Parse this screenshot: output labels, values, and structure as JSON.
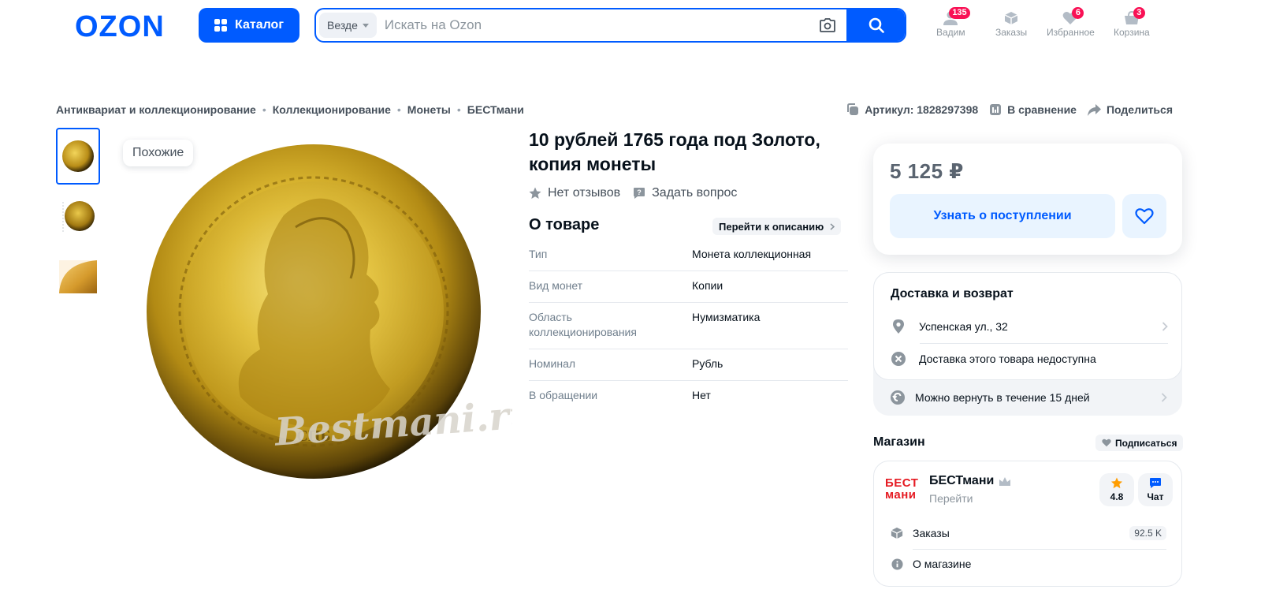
{
  "header": {
    "logo_text": "OZON",
    "catalog_label": "Каталог",
    "search": {
      "scope": "Везде",
      "placeholder": "Искать на Ozon"
    },
    "nav": [
      {
        "label": "Вадим",
        "badge": "135",
        "icon": "user-icon"
      },
      {
        "label": "Заказы",
        "badge": "",
        "icon": "box-icon"
      },
      {
        "label": "Избранное",
        "badge": "6",
        "icon": "heart-icon"
      },
      {
        "label": "Корзина",
        "badge": "3",
        "icon": "cart-icon"
      }
    ]
  },
  "breadcrumb": [
    "Антиквариат и коллекционирование",
    "Коллекционирование",
    "Монеты",
    "БЕСТмани"
  ],
  "meta": {
    "article": "Артикул: 1828297398",
    "compare": "В сравнение",
    "share": "Поделиться"
  },
  "gallery": {
    "similar_label": "Похожие",
    "watermark": "Bestmani.ru"
  },
  "product": {
    "title": "10 рублей 1765 года под Золото, копия монеты",
    "reviews": "Нет отзывов",
    "ask": "Задать вопрос",
    "about_title": "О товаре",
    "goto_desc": "Перейти к описанию",
    "specs": [
      {
        "key": "Тип",
        "value": "Монета коллекционная"
      },
      {
        "key": "Вид монет",
        "value": "Копии"
      },
      {
        "key": "Область коллекционирования",
        "value": "Нумизматика"
      },
      {
        "key": "Номинал",
        "value": "Рубль"
      },
      {
        "key": "В обращении",
        "value": "Нет"
      }
    ]
  },
  "buy": {
    "price": "5 125 ₽",
    "notify_label": "Узнать о поступлении"
  },
  "delivery": {
    "title": "Доставка и возврат",
    "address": "Успенская ул., 32",
    "unavailable": "Доставка этого товара недоступна",
    "return": "Можно вернуть в течение 15 дней"
  },
  "shop": {
    "section_title": "Магазин",
    "subscribe": "Подписаться",
    "logo_line1": "БЕСТ",
    "logo_line2": "мани",
    "name": "БЕСТмани",
    "go": "Перейти",
    "rating": "4.8",
    "chat": "Чат",
    "orders_label": "Заказы",
    "orders_count": "92.5 K",
    "about": "О магазине"
  },
  "colors": {
    "brand": "#005bff",
    "badge": "#f91155",
    "shop_red": "#e51b23"
  }
}
